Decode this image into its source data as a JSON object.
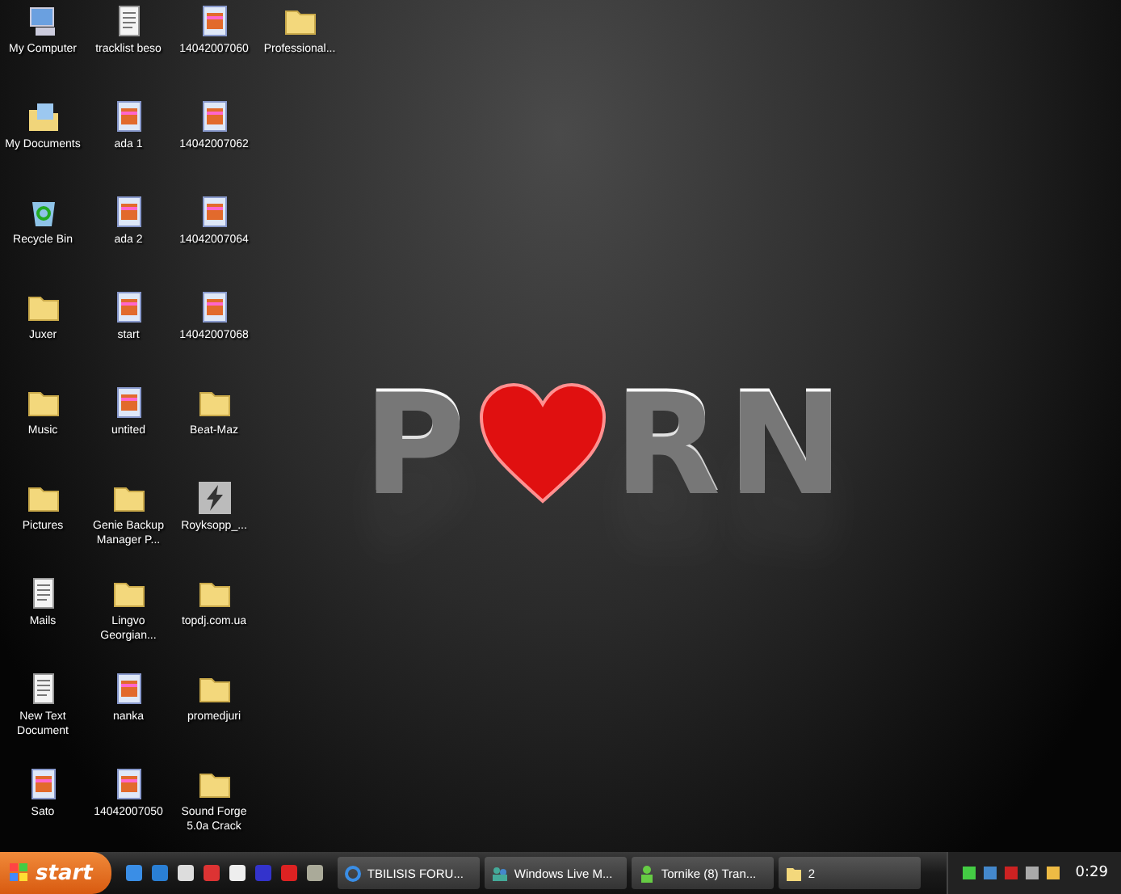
{
  "desktop_icons": [
    {
      "label": "My Computer",
      "kind": "computer"
    },
    {
      "label": "My Documents",
      "kind": "documents"
    },
    {
      "label": "Recycle Bin",
      "kind": "recycle"
    },
    {
      "label": "Juxer",
      "kind": "folder"
    },
    {
      "label": "Music",
      "kind": "folder"
    },
    {
      "label": "Pictures",
      "kind": "folder"
    },
    {
      "label": "Mails",
      "kind": "text"
    },
    {
      "label": "New Text Document",
      "kind": "text"
    },
    {
      "label": "Sato",
      "kind": "image"
    },
    {
      "label": "tracklist beso",
      "kind": "text"
    },
    {
      "label": "ada 1",
      "kind": "image"
    },
    {
      "label": "ada 2",
      "kind": "image"
    },
    {
      "label": "start",
      "kind": "image"
    },
    {
      "label": "untited",
      "kind": "image"
    },
    {
      "label": "Genie Backup Manager P...",
      "kind": "folder"
    },
    {
      "label": "Lingvo Georgian...",
      "kind": "folder"
    },
    {
      "label": "nanka",
      "kind": "image"
    },
    {
      "label": "14042007050",
      "kind": "image"
    },
    {
      "label": "14042007060",
      "kind": "image"
    },
    {
      "label": "14042007062",
      "kind": "image"
    },
    {
      "label": "14042007064",
      "kind": "image"
    },
    {
      "label": "14042007068",
      "kind": "image"
    },
    {
      "label": "Beat-Maz",
      "kind": "folder"
    },
    {
      "label": "Royksopp_...",
      "kind": "app"
    },
    {
      "label": "topdj.com.ua",
      "kind": "folder"
    },
    {
      "label": "promedjuri",
      "kind": "folder"
    },
    {
      "label": "Sound Forge 5.0a Crack",
      "kind": "folder"
    },
    {
      "label": "Professional...",
      "kind": "folder"
    }
  ],
  "wallpaper": {
    "left": "P",
    "right": "RN"
  },
  "taskbar": {
    "start": "start",
    "windows": [
      {
        "label": "TBILISIS FORU...",
        "kind": "browser"
      },
      {
        "label": "Windows Live M...",
        "kind": "messenger"
      },
      {
        "label": "Tornike (8) Tran...",
        "kind": "transfer"
      },
      {
        "label": "2",
        "kind": "folder"
      }
    ],
    "clock": "0:29"
  }
}
